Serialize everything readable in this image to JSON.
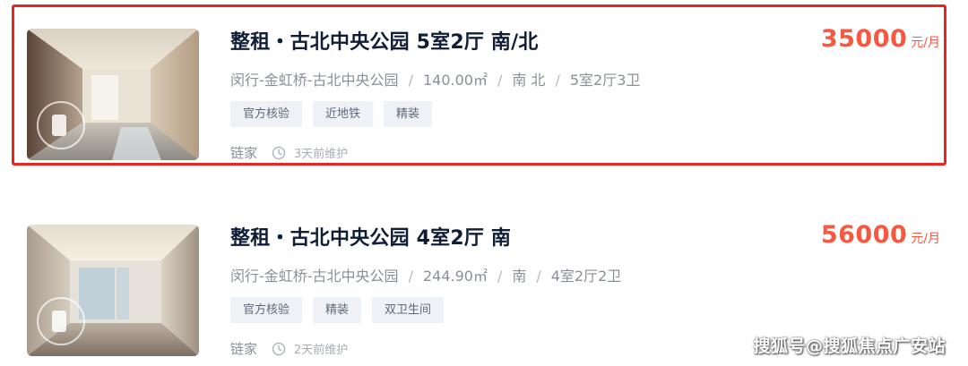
{
  "listings": [
    {
      "title": "整租・古北中央公园 5室2厅 南/北",
      "location": "闵行-金虹桥-古北中央公园",
      "area": "140.00㎡",
      "orientation": "南 北",
      "layout": "5室2厅3卫",
      "tags": [
        "官方核验",
        "近地铁",
        "精装"
      ],
      "agency": "链家",
      "updated": "3天前维护",
      "price": "35000",
      "price_unit": "元/月",
      "selected": true
    },
    {
      "title": "整租・古北中央公园 4室2厅 南",
      "location": "闵行-金虹桥-古北中央公园",
      "area": "244.90㎡",
      "orientation": "南",
      "layout": "4室2厅2卫",
      "tags": [
        "官方核验",
        "精装",
        "双卫生间"
      ],
      "agency": "链家",
      "updated": "2天前维护",
      "price": "56000",
      "price_unit": "元/月",
      "selected": false
    }
  ],
  "separator": "/",
  "watermark": "搜狐号@搜狐焦点广安站",
  "colors": {
    "highlight_border": "#e8251e",
    "price": "#fa5741",
    "title": "#101d37",
    "tag_bg": "#eef1f5"
  },
  "icons": {
    "clock": "clock-icon",
    "vr": "vr-360-icon"
  }
}
